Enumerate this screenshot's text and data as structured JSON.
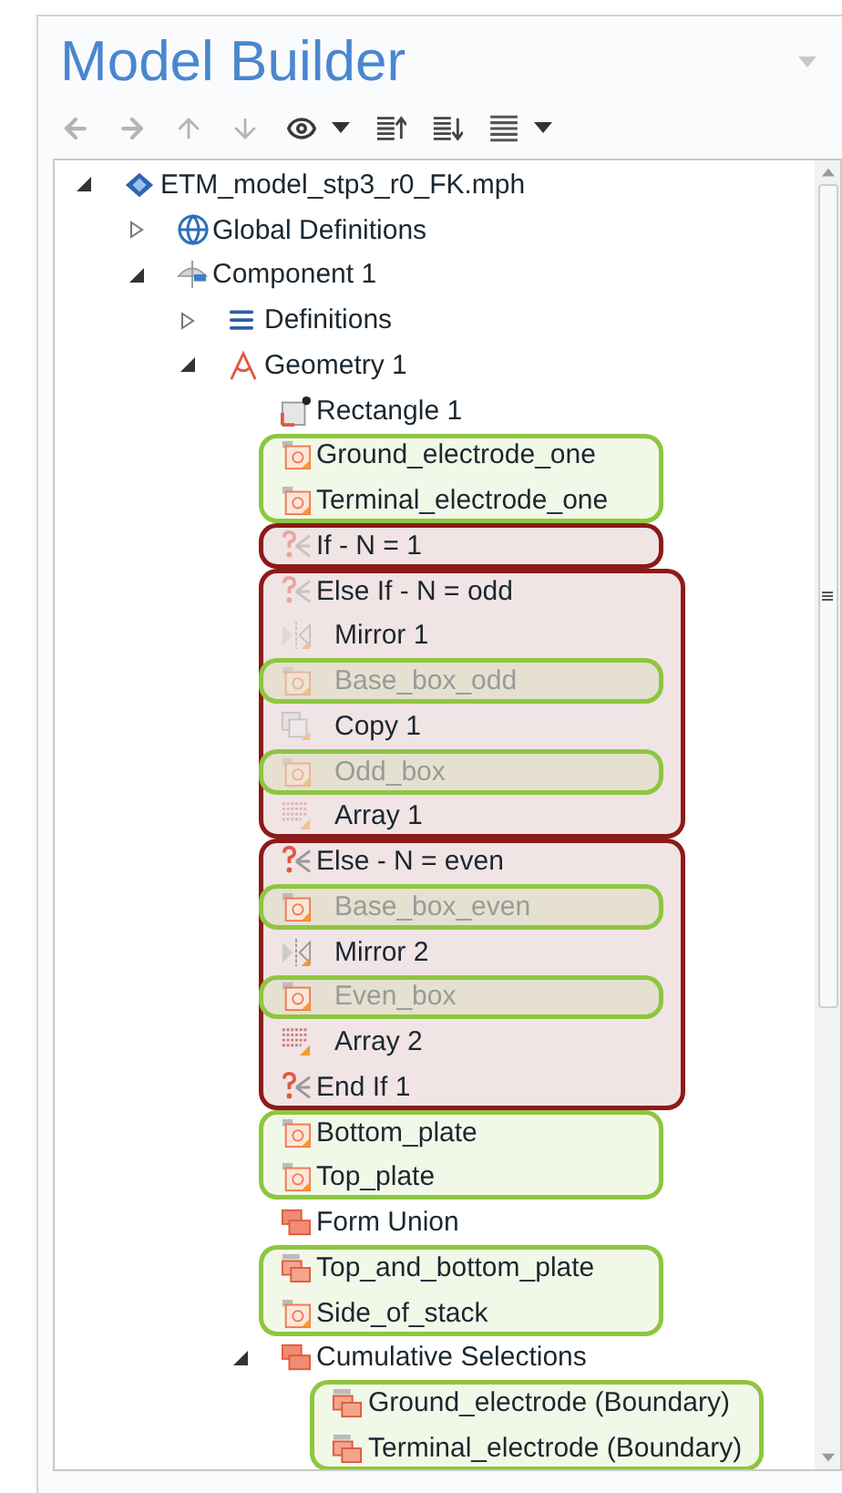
{
  "panel": {
    "title": "Model Builder"
  },
  "tree": [
    {
      "label": "ETM_model_stp3_r0_FK.mph",
      "kind": "model",
      "expanded": true,
      "children": [
        {
          "label": "Global Definitions",
          "kind": "globe",
          "expanded": false
        },
        {
          "label": "Component 1",
          "kind": "component",
          "expanded": true,
          "children": [
            {
              "label": "Definitions",
              "kind": "definitions",
              "expanded": false
            },
            {
              "label": "Geometry 1",
              "kind": "geometry",
              "expanded": true,
              "children": [
                {
                  "label": "Rectangle 1",
                  "kind": "rectangle",
                  "disabled": false,
                  "inactive": false
                },
                {
                  "kind": "annotation",
                  "color": "#8dc63f",
                  "items": [
                    {
                      "label": "Ground_electrode_one",
                      "kind": "selection",
                      "disabled": false,
                      "inactive": false
                    },
                    {
                      "label": "Terminal_electrode_one",
                      "kind": "selection",
                      "disabled": false,
                      "inactive": false
                    }
                  ]
                },
                {
                  "kind": "annotation",
                  "color": "#8b1a1a",
                  "items": [
                    {
                      "label": "If - N = 1",
                      "kind": "if",
                      "disabled": false,
                      "inactive": true
                    }
                  ]
                },
                {
                  "kind": "annotation",
                  "color": "#8b1a1a",
                  "items": [
                    {
                      "label": "Else If - N = odd",
                      "kind": "if",
                      "disabled": false,
                      "inactive": true,
                      "children": [
                        {
                          "label": "Mirror 1",
                          "kind": "mirror",
                          "disabled": false,
                          "inactive": true
                        },
                        {
                          "kind": "annotation",
                          "color": "#8dc63f",
                          "items": [
                            {
                              "label": "Base_box_odd",
                              "kind": "selection",
                              "disabled": true,
                              "inactive": true
                            }
                          ]
                        },
                        {
                          "label": "Copy 1",
                          "kind": "copy",
                          "disabled": false,
                          "inactive": true
                        },
                        {
                          "kind": "annotation",
                          "color": "#8dc63f",
                          "items": [
                            {
                              "label": "Odd_box",
                              "kind": "selection",
                              "disabled": true,
                              "inactive": true
                            }
                          ]
                        },
                        {
                          "label": "Array 1",
                          "kind": "array",
                          "disabled": false,
                          "inactive": true
                        }
                      ]
                    }
                  ]
                },
                {
                  "kind": "annotation",
                  "color": "#8b1a1a",
                  "items": [
                    {
                      "label": "Else - N = even",
                      "kind": "if",
                      "disabled": false,
                      "inactive": false,
                      "children": [
                        {
                          "kind": "annotation",
                          "color": "#8dc63f",
                          "items": [
                            {
                              "label": "Base_box_even",
                              "kind": "selection",
                              "disabled": true,
                              "inactive": false
                            }
                          ]
                        },
                        {
                          "label": "Mirror 2",
                          "kind": "mirror",
                          "disabled": false,
                          "inactive": false
                        },
                        {
                          "kind": "annotation",
                          "color": "#8dc63f",
                          "items": [
                            {
                              "label": "Even_box",
                              "kind": "selection",
                              "disabled": true,
                              "inactive": false
                            }
                          ]
                        },
                        {
                          "label": "Array 2",
                          "kind": "array",
                          "disabled": false,
                          "inactive": false
                        }
                      ]
                    },
                    {
                      "label": "End If 1",
                      "kind": "if",
                      "disabled": false,
                      "inactive": false
                    }
                  ]
                },
                {
                  "kind": "annotation",
                  "color": "#8dc63f",
                  "items": [
                    {
                      "label": "Bottom_plate",
                      "kind": "selection",
                      "disabled": false,
                      "inactive": false
                    },
                    {
                      "label": "Top_plate",
                      "kind": "selection",
                      "disabled": false,
                      "inactive": false
                    }
                  ]
                },
                {
                  "label": "Form Union",
                  "kind": "union",
                  "disabled": false,
                  "inactive": false
                },
                {
                  "kind": "annotation",
                  "color": "#8dc63f",
                  "items": [
                    {
                      "label": "Top_and_bottom_plate",
                      "kind": "union-selection",
                      "disabled": false,
                      "inactive": false
                    },
                    {
                      "label": "Side_of_stack",
                      "kind": "selection",
                      "disabled": false,
                      "inactive": false
                    }
                  ]
                },
                {
                  "label": "Cumulative Selections",
                  "kind": "union",
                  "expanded": true,
                  "disabled": false,
                  "inactive": false,
                  "children": [
                    {
                      "kind": "annotation",
                      "color": "#8dc63f",
                      "items": [
                        {
                          "label": "Ground_electrode (Boundary)",
                          "kind": "union-selection",
                          "disabled": false,
                          "inactive": false
                        },
                        {
                          "label": "Terminal_electrode (Boundary)",
                          "kind": "union-selection",
                          "disabled": false,
                          "inactive": false
                        }
                      ]
                    }
                  ]
                }
              ]
            }
          ]
        }
      ]
    }
  ]
}
